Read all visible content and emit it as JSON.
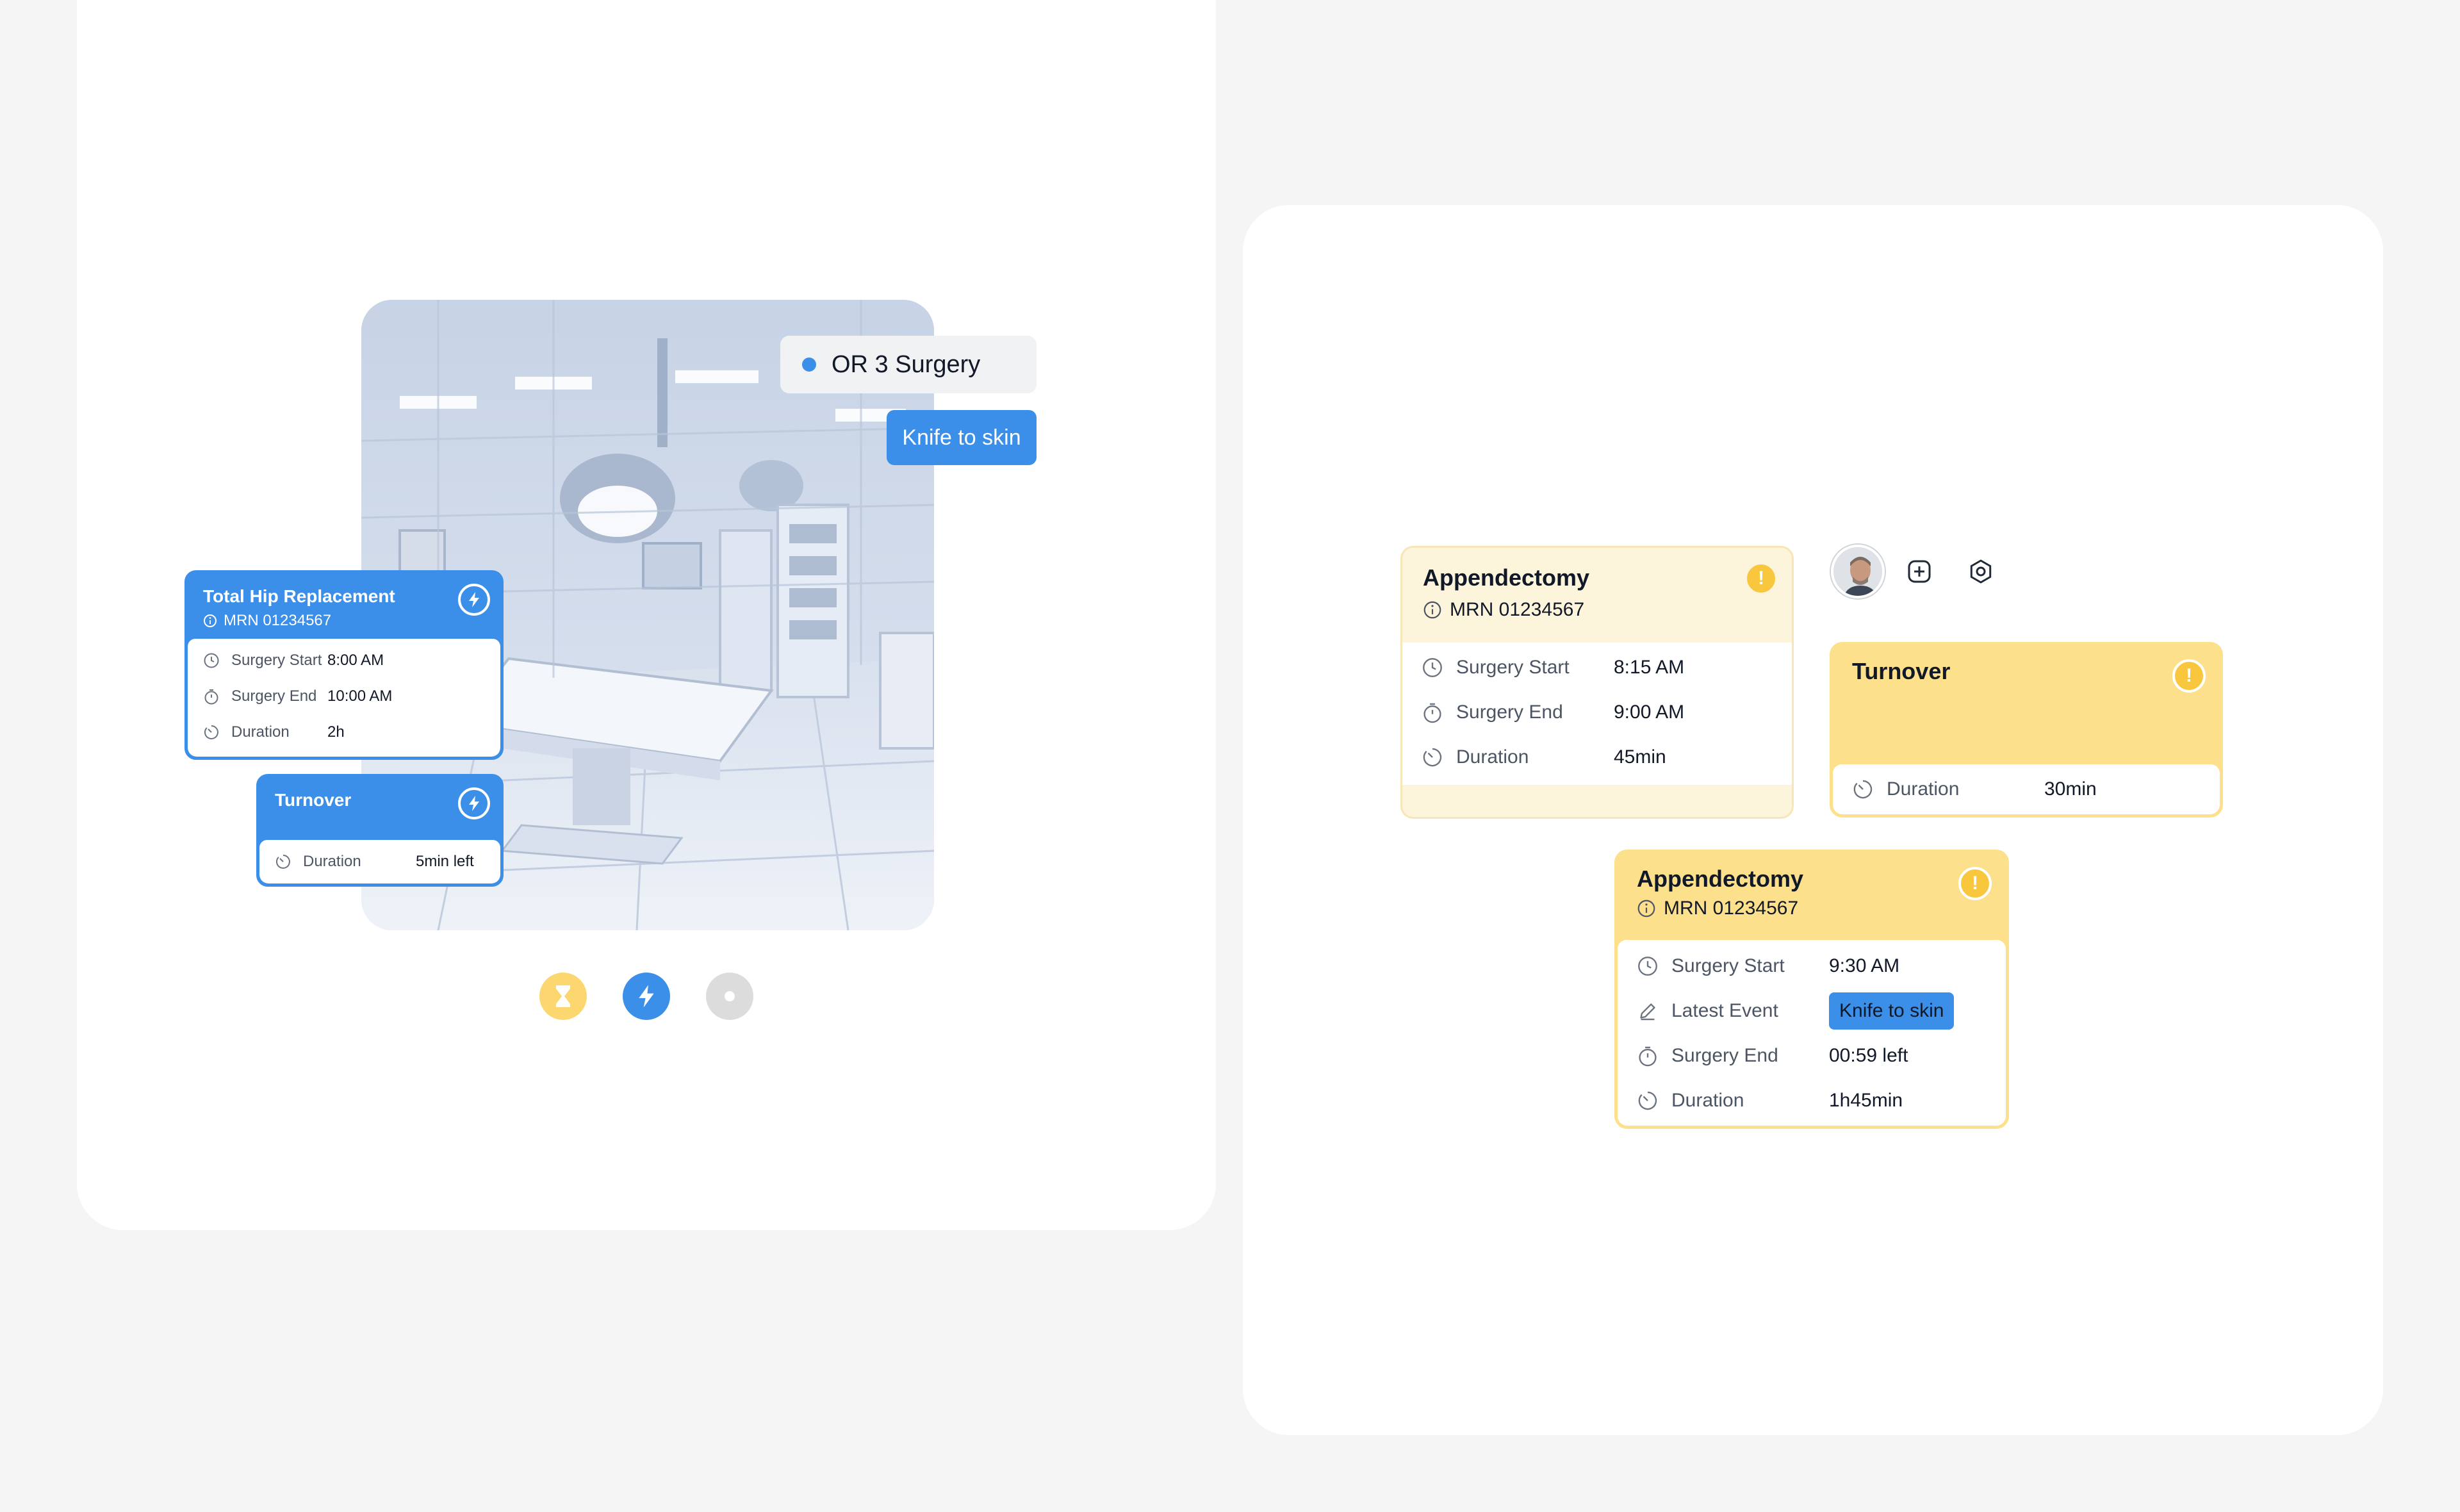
{
  "left_panel": {
    "room_tag": {
      "label": "OR 3 Surgery",
      "status_color": "#3b8fe8"
    },
    "event_tag": {
      "label": "Knife to skin"
    },
    "hip_card": {
      "title": "Total Hip Replacement",
      "mrn": "MRN 01234567",
      "rows": [
        {
          "label": "Surgery Start",
          "value": "8:00 AM",
          "icon": "clock-icon"
        },
        {
          "label": "Surgery End",
          "value": "10:00 AM",
          "icon": "stopwatch-icon"
        },
        {
          "label": "Duration",
          "value": "2h",
          "icon": "timer-icon"
        }
      ]
    },
    "turnover_card": {
      "title": "Turnover",
      "rows": [
        {
          "label": "Duration",
          "value": "5min left",
          "icon": "timer-icon"
        }
      ]
    },
    "states": [
      {
        "name": "waiting",
        "icon": "hourglass-icon",
        "color": "#fcd76f"
      },
      {
        "name": "in-progress",
        "icon": "bolt-icon",
        "color": "#3b8fe8"
      },
      {
        "name": "idle",
        "icon": "dot-icon",
        "color": "#dcdcdc"
      }
    ]
  },
  "right_panel": {
    "appendectomy_card_1": {
      "title": "Appendectomy",
      "mrn": "MRN 01234567",
      "rows": [
        {
          "label": "Surgery Start",
          "value": "8:15 AM",
          "icon": "clock-icon"
        },
        {
          "label": "Surgery End",
          "value": "9:00 AM",
          "icon": "stopwatch-icon"
        },
        {
          "label": "Duration",
          "value": "45min",
          "icon": "timer-icon"
        }
      ]
    },
    "turnover_card": {
      "title": "Turnover",
      "rows": [
        {
          "label": "Duration",
          "value": "30min",
          "icon": "timer-icon"
        }
      ]
    },
    "appendectomy_card_2": {
      "title": "Appendectomy",
      "mrn": "MRN 01234567",
      "rows": [
        {
          "label": "Surgery Start",
          "value": "9:30 AM",
          "icon": "clock-icon"
        },
        {
          "label": "Latest Event",
          "value": "Knife to skin",
          "icon": "pen-icon"
        },
        {
          "label": "Surgery End",
          "value": "00:59 left",
          "icon": "stopwatch-icon"
        },
        {
          "label": "Duration",
          "value": "1h45min",
          "icon": "timer-icon"
        }
      ]
    },
    "warning_badge": "!",
    "colors": {
      "yellow": "#fde08b",
      "pale_yellow": "#fdf4dc",
      "blue": "#3b8fe8",
      "warn": "#f9c73d"
    }
  }
}
